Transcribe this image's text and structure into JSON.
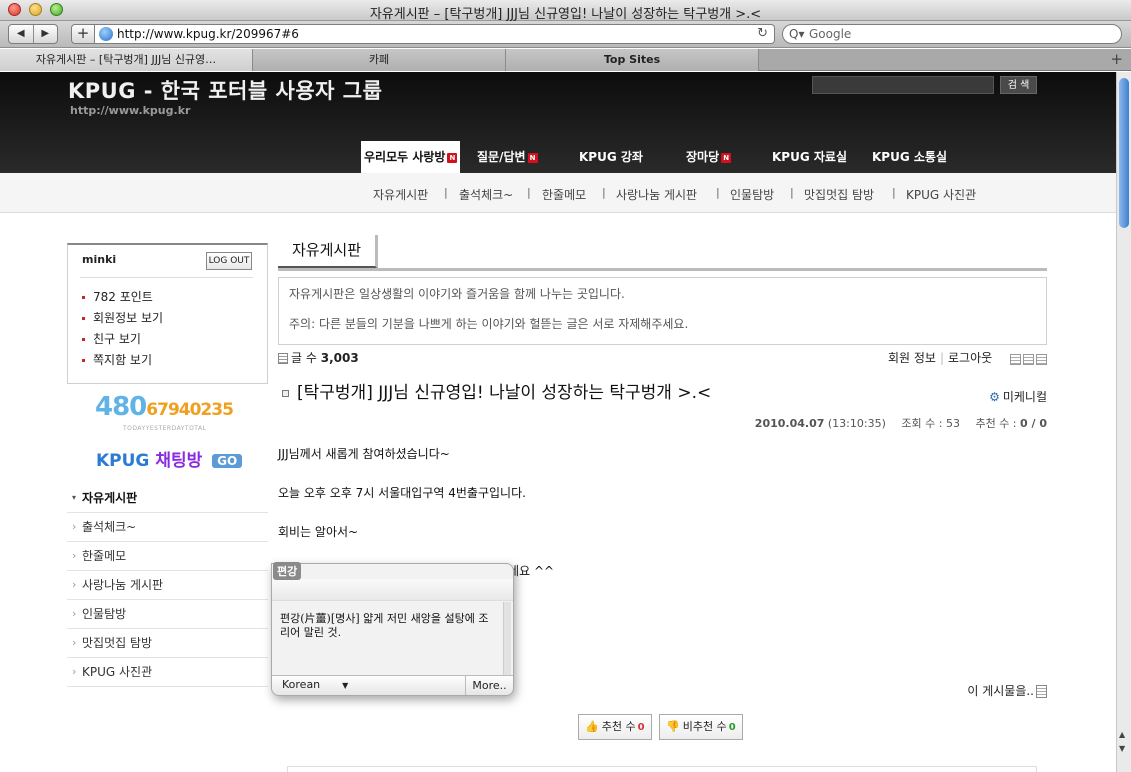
{
  "window": {
    "title": "자유게시판 – [탁구벙개] JJJ님 신규영입! 나날이 성장하는 탁구벙개 >.<"
  },
  "toolbar": {
    "back_glyph": "◀",
    "forward_glyph": "▶",
    "add_glyph": "+",
    "url": "http://www.kpug.kr/209967#6",
    "reload_glyph": "↻",
    "search_placeholder": "Google",
    "search_glyph": "Q▾"
  },
  "tabs": [
    {
      "label": "자유게시판 – [탁구벙개] JJJ님 신규영…"
    },
    {
      "label": "카페"
    },
    {
      "label": "Top Sites"
    }
  ],
  "tab_add_glyph": "+",
  "header": {
    "site_title": "KPUG - 한국 포터블 사용자 그룹",
    "site_url": "http://www.kpug.kr",
    "search_button": "검 색"
  },
  "mainnav": [
    {
      "label": "우리모두 사랑방",
      "badge": "N"
    },
    {
      "label": "질문/답변",
      "badge": "N"
    },
    {
      "label": "KPUG 강좌"
    },
    {
      "label": "장마당",
      "badge": "N"
    },
    {
      "label": "KPUG 자료실"
    },
    {
      "label": "KPUG 소통실"
    }
  ],
  "subnav": [
    "자유게시판",
    "출석체크~",
    "한줄메모",
    "사랑나눔 게시판",
    "인물탐방",
    "맛집멋집 탐방",
    "KPUG 사진관"
  ],
  "subnav_sep": "|",
  "login": {
    "username": "minki",
    "logout": "LOG OUT",
    "links": [
      "782 포인트",
      "회원정보 보기",
      "친구 보기",
      "쪽지함 보기"
    ]
  },
  "counter": {
    "total": "480",
    "today_yesterday": "67940235",
    "labels": "TODAYYESTERDAYTOTAL"
  },
  "chat_logo": {
    "kpug": "KPUG",
    "chat": "채팅방",
    "go": "GO"
  },
  "sidemenu": [
    "자유게시판",
    "출석체크~",
    "한줄메모",
    "사랑나눔 게시판",
    "인물탐방",
    "맛집멋집 탐방",
    "KPUG 사진관"
  ],
  "board": {
    "tab": "자유게시판",
    "desc1": "자유게시판은 일상생활의 이야기와 즐거움을 함께 나누는 곳입니다.",
    "desc2": "주의: 다른 분들의 기분을 나쁘게 하는 이야기와 헐뜯는 글은 서로 자제해주세요.",
    "count_label": "글 수",
    "count": "3,003",
    "member_info": "회원 정보",
    "sep": "|",
    "logout": "로그아웃"
  },
  "post": {
    "title": "[탁구벙개] JJJ님 신규영입! 나날이 성장하는 탁구벙개 >.<",
    "author": "미케니컬",
    "date": "2010.04.07",
    "time": "(13:10:35)",
    "views_label": "조회 수 :",
    "views": "53",
    "votes_label": "추천 수 :",
    "votes": "0 / 0",
    "body": [
      "JJJ님께서 새롭게 참여하셨습니다~",
      "오늘 오후 오후 7시 서울대입구역 4번출구입니다.",
      "회비는 알아서~",
      "         님과 백군님은 오늘 참석을 못하실것 같네요 ^^"
    ],
    "more_posts": "이 게시물을..",
    "recommend": "추천 수",
    "recommend_count": "0",
    "unrecommend": "비추천 수",
    "unrecommend_count": "0"
  },
  "dictionary": {
    "word": "편강",
    "definition": "편강(片薑)[명사] 얇게 저민 새앙을 설탕에 조리어 말린 것.",
    "language": "Korean",
    "language_arrow": "▼",
    "more": "More.."
  },
  "colors": {
    "header_bg": "#1a1a1a",
    "new_badge": "#d2111c",
    "bullet": "#c1272d"
  }
}
